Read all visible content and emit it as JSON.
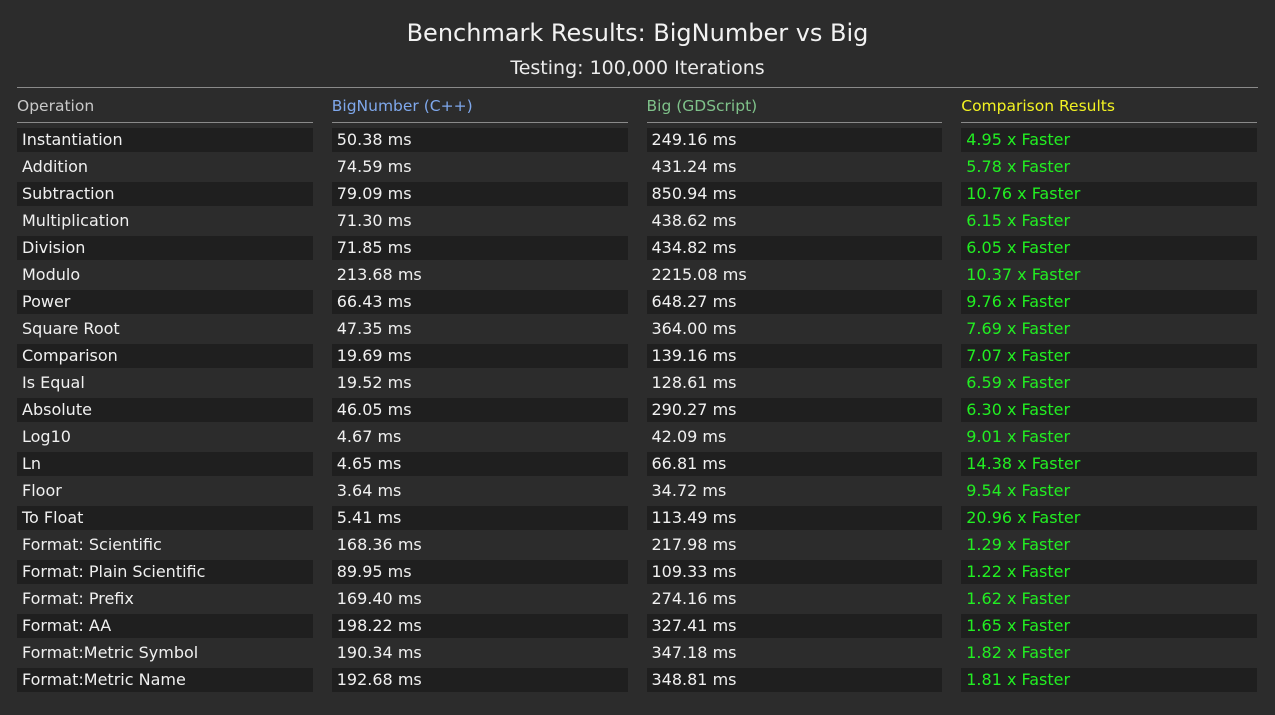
{
  "title": "Benchmark Results: BigNumber vs Big",
  "subtitle": "Testing: 100,000 Iterations",
  "colors": {
    "background": "#2c2c2c",
    "row_stripe": "#1f1f1f",
    "header_operation": "#c9c9c9",
    "header_cpp": "#7fa8ec",
    "header_gdscript": "#7fc28a",
    "header_comparison": "#f2f222",
    "comparison_text": "#22ee22"
  },
  "headers": {
    "operation": "Operation",
    "cpp": "BigNumber (C++)",
    "gdscript": "Big (GDScript)",
    "comparison": "Comparison Results"
  },
  "rows": [
    {
      "operation": "Instantiation",
      "cpp": "50.38 ms",
      "gdscript": "249.16 ms",
      "comparison": "4.95 x Faster"
    },
    {
      "operation": "Addition",
      "cpp": "74.59 ms",
      "gdscript": "431.24 ms",
      "comparison": "5.78 x Faster"
    },
    {
      "operation": "Subtraction",
      "cpp": "79.09 ms",
      "gdscript": "850.94 ms",
      "comparison": "10.76 x Faster"
    },
    {
      "operation": "Multiplication",
      "cpp": "71.30 ms",
      "gdscript": "438.62 ms",
      "comparison": "6.15 x Faster"
    },
    {
      "operation": "Division",
      "cpp": "71.85 ms",
      "gdscript": "434.82 ms",
      "comparison": "6.05 x Faster"
    },
    {
      "operation": "Modulo",
      "cpp": "213.68 ms",
      "gdscript": "2215.08 ms",
      "comparison": "10.37 x Faster"
    },
    {
      "operation": "Power",
      "cpp": "66.43 ms",
      "gdscript": "648.27 ms",
      "comparison": "9.76 x Faster"
    },
    {
      "operation": "Square Root",
      "cpp": "47.35 ms",
      "gdscript": "364.00 ms",
      "comparison": "7.69 x Faster"
    },
    {
      "operation": "Comparison",
      "cpp": "19.69 ms",
      "gdscript": "139.16 ms",
      "comparison": "7.07 x Faster"
    },
    {
      "operation": "Is Equal",
      "cpp": "19.52 ms",
      "gdscript": "128.61 ms",
      "comparison": "6.59 x Faster"
    },
    {
      "operation": "Absolute",
      "cpp": "46.05 ms",
      "gdscript": "290.27 ms",
      "comparison": "6.30 x Faster"
    },
    {
      "operation": "Log10",
      "cpp": "4.67 ms",
      "gdscript": "42.09 ms",
      "comparison": "9.01 x Faster"
    },
    {
      "operation": "Ln",
      "cpp": "4.65 ms",
      "gdscript": "66.81 ms",
      "comparison": "14.38 x Faster"
    },
    {
      "operation": "Floor",
      "cpp": "3.64 ms",
      "gdscript": "34.72 ms",
      "comparison": "9.54 x Faster"
    },
    {
      "operation": "To Float",
      "cpp": "5.41 ms",
      "gdscript": "113.49 ms",
      "comparison": "20.96 x Faster"
    },
    {
      "operation": "Format: Scientific",
      "cpp": "168.36 ms",
      "gdscript": "217.98 ms",
      "comparison": "1.29 x Faster"
    },
    {
      "operation": "Format: Plain Scientific",
      "cpp": "89.95 ms",
      "gdscript": "109.33 ms",
      "comparison": "1.22 x Faster"
    },
    {
      "operation": "Format: Prefix",
      "cpp": "169.40 ms",
      "gdscript": "274.16 ms",
      "comparison": "1.62 x Faster"
    },
    {
      "operation": "Format: AA",
      "cpp": "198.22 ms",
      "gdscript": "327.41 ms",
      "comparison": "1.65 x Faster"
    },
    {
      "operation": "Format:Metric Symbol",
      "cpp": "190.34 ms",
      "gdscript": "347.18 ms",
      "comparison": "1.82 x Faster"
    },
    {
      "operation": "Format:Metric Name",
      "cpp": "192.68 ms",
      "gdscript": "348.81 ms",
      "comparison": "1.81 x Faster"
    }
  ]
}
